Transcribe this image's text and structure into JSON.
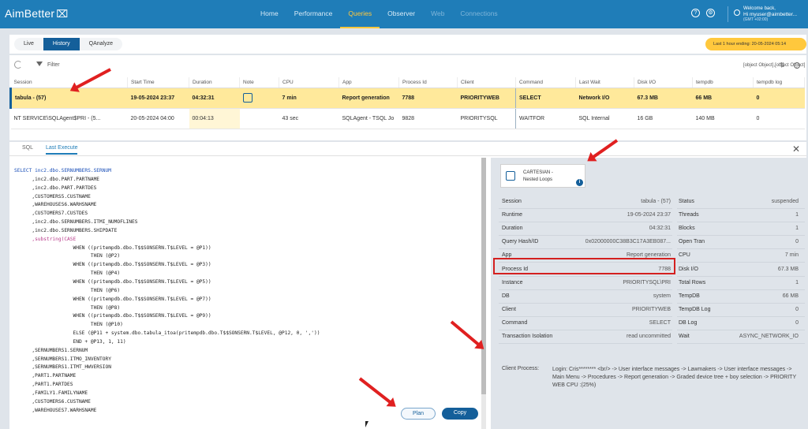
{
  "app": {
    "logo": "AimBetter",
    "logo_mark": "⌧"
  },
  "nav": [
    {
      "label": "Home"
    },
    {
      "label": "Performance"
    },
    {
      "label": "Queries"
    },
    {
      "label": "Observer"
    },
    {
      "label": "Web"
    },
    {
      "label": "Connections"
    }
  ],
  "user": {
    "welcome": "Welcome back,",
    "name": "Hi myuser@aimbetter...",
    "tz": "(GMT +02:00)"
  },
  "modes": {
    "live": "Live",
    "history": "History",
    "qanalyze": "QAnalyze"
  },
  "range": {
    "label": "Last 1 hour ending: 20-05-2024 05:14"
  },
  "grid": {
    "filter": "Filter",
    "rows": [
      {
        "session": "tabula - (57)",
        "start": "19-05-2024 23:37",
        "duration": "04:32:31",
        "cpu": "7 min",
        "app": "Report generation",
        "pid": "7788",
        "client": "PRIORITYWEB",
        "command": "SELECT",
        "wait": "Network I/O",
        "disk": "67.3 MB",
        "tempdb": "66 MB",
        "tlog": "0"
      },
      {
        "session": "NT SERVICE\\SQLAgent$PRI - (5...",
        "start": "20-05-2024 04:00",
        "duration": "00:04:13",
        "cpu": "43 sec",
        "app": "SQLAgent - TSQL Jo",
        "pid": "9828",
        "client": "PRIORITYSQL",
        "command": "WAITFOR",
        "wait": "SQL Internal",
        "disk": "16 GB",
        "tempdb": "140 MB",
        "tlog": "0"
      }
    ],
    "headers": [
      "Session",
      "Start Time",
      "Duration",
      "Note",
      "CPU",
      "App",
      "Process Id",
      "Client",
      "Command",
      "Last Wait",
      "Disk I/O",
      "tempdb",
      "tempdb log"
    ]
  },
  "tabs": {
    "sql": "SQL",
    "last": "Last Execute"
  },
  "code": [
    "SELECT inc2.dbo.SERNUMBERS.SERNUM",
    "      ,inc2.dbo.PART.PARTNAME",
    "      ,inc2.dbo.PART.PARTDES",
    "      ,CUSTOMERS5.CUSTNAME",
    "      ,WAREHOUSES6.WARHSNAME",
    "      ,CUSTOMERS7.CUSTDES",
    "      ,inc2.dbo.SERNUMBERS.ITMI_NUMOFLINES",
    "      ,inc2.dbo.SERNUMBERS.SHIPDATE",
    "      ,substring(CASE",
    "                    WHEN ((pritempdb.dbo.T$$SONSERN.T$LEVEL = @P1))",
    "                          THEN (@P2)",
    "                    WHEN ((pritempdb.dbo.T$$SONSERN.T$LEVEL = @P3))",
    "                          THEN (@P4)",
    "                    WHEN ((pritempdb.dbo.T$$SONSERN.T$LEVEL = @P5))",
    "                          THEN (@P6)",
    "                    WHEN ((pritempdb.dbo.T$$SONSERN.T$LEVEL = @P7))",
    "                          THEN (@P8)",
    "                    WHEN ((pritempdb.dbo.T$$SONSERN.T$LEVEL = @P9))",
    "                          THEN (@P10)",
    "                    ELSE (@P11 + system.dbo.tabula_itoa(pritempdb.dbo.T$$SONSERN.T$LEVEL, @P12, 0, ','))",
    "                    END + @P13, 1, 11)",
    "      ,SERNUMBERS1.SERNUM",
    "      ,SERNUMBERS1.ITMO_INVENTORY",
    "      ,SERNUMBERS1.ITMT_HWVERSION",
    "      ,PART1.PARTNAME",
    "      ,PART1.PARTDES",
    "      ,FAMILY1.FAMILYNAME",
    "      ,CUSTOMERS6.CUSTNAME",
    "      ,WAREHOUSES7.WARHSNAME"
  ],
  "buttons": {
    "plan": "Plan",
    "copy": "Copy"
  },
  "plan": {
    "line1": "CARTESIAN -",
    "line2": "Nested Loops",
    "info": "i"
  },
  "details_left": [
    {
      "k": "Session",
      "v": "tabula - (57)"
    },
    {
      "k": "Runtime",
      "v": "19-05-2024 23:37"
    },
    {
      "k": "Duration",
      "v": "04:32:31"
    },
    {
      "k": "Query Hash/ID",
      "v": "0x02000000C38B3C17A3EB087..."
    },
    {
      "k": "App",
      "v": "Report generation"
    },
    {
      "k": "Process Id",
      "v": "7788"
    },
    {
      "k": "Instance",
      "v": "PRIORITYSQL\\PRI"
    },
    {
      "k": "DB",
      "v": "system"
    },
    {
      "k": "Client",
      "v": "PRIORITYWEB"
    },
    {
      "k": "Command",
      "v": "SELECT"
    },
    {
      "k": "Transaction Isolation",
      "v": "read uncommitted"
    }
  ],
  "details_right": [
    {
      "k": "Status",
      "v": "suspended"
    },
    {
      "k": "Threads",
      "v": "1"
    },
    {
      "k": "Blocks",
      "v": "1"
    },
    {
      "k": "Open Tran",
      "v": "0"
    },
    {
      "k": "CPU",
      "v": "7 min"
    },
    {
      "k": "Disk I/O",
      "v": "67.3 MB"
    },
    {
      "k": "Total Rows",
      "v": "1"
    },
    {
      "k": "TempDB",
      "v": "66 MB"
    },
    {
      "k": "TempDB Log",
      "v": "0"
    },
    {
      "k": "DB Log",
      "v": "0"
    },
    {
      "k": "Wait",
      "v": "ASYNC_NETWORK_IO"
    }
  ],
  "client_process": {
    "k": "Client Process:",
    "v": "Login: Cris******** <br/> -> User interface messages -> Lawmakers -> User interface messages -> Main Menu -> Procedures -> Report generation -> Graded device tree + boy selection -> PRIORITY WEB CPU :(25%)"
  }
}
